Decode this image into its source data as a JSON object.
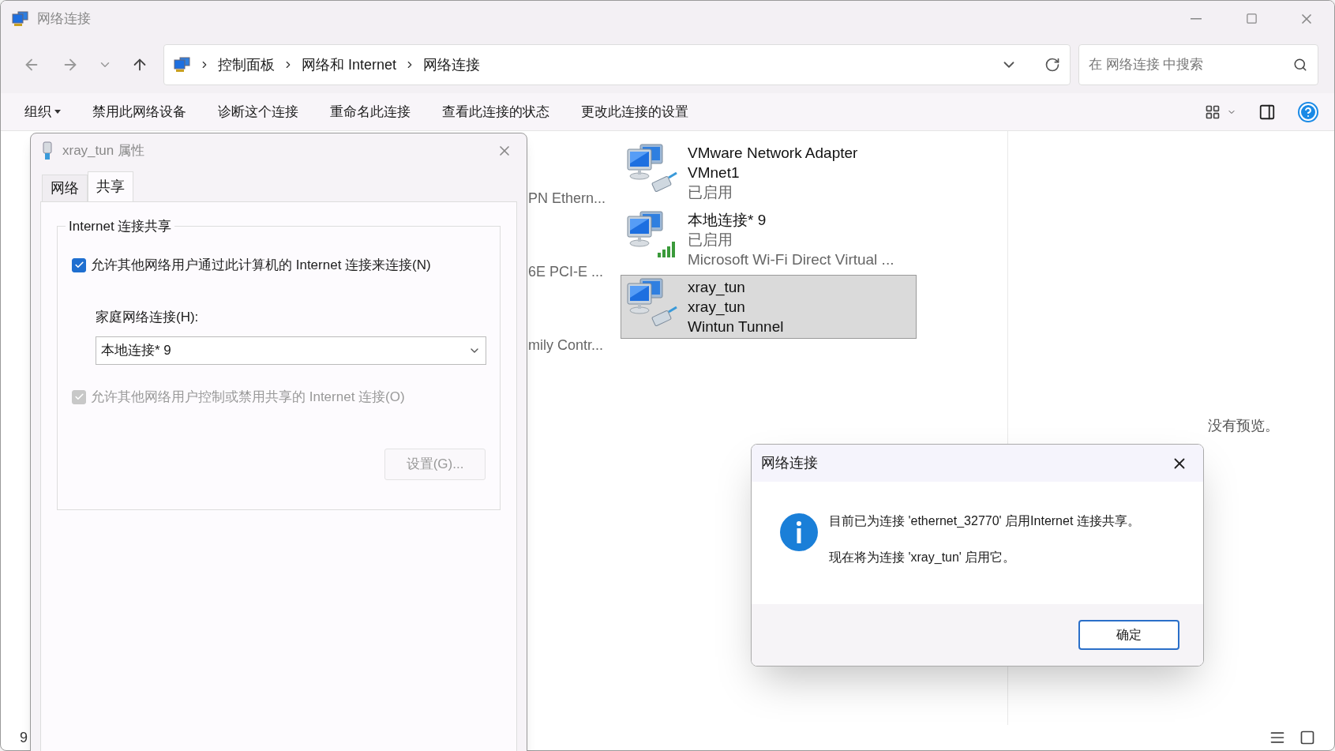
{
  "window": {
    "title": "网络连接"
  },
  "address_bar": {
    "breadcrumbs": [
      "控制面板",
      "网络和 Internet",
      "网络连接"
    ]
  },
  "search": {
    "placeholder": "在 网络连接 中搜索"
  },
  "toolbar": {
    "items": [
      {
        "label": "组织",
        "kind": "menu"
      },
      {
        "label": "禁用此网络设备",
        "kind": "plain"
      },
      {
        "label": "诊断这个连接",
        "kind": "plain"
      },
      {
        "label": "重命名此连接",
        "kind": "plain"
      },
      {
        "label": "查看此连接的状态",
        "kind": "plain"
      },
      {
        "label": "更改此连接的设置",
        "kind": "plain"
      }
    ]
  },
  "left_column_fragments": [
    "PN Ethern...",
    "6E PCI-E ...",
    "mily Contr..."
  ],
  "connections": [
    {
      "lines": [
        "VMware Network Adapter VMnet1",
        "已启用"
      ],
      "kind": "wired",
      "selected": false
    },
    {
      "lines": [
        "本地连接* 9",
        "已启用",
        "Microsoft Wi-Fi Direct Virtual ..."
      ],
      "kind": "wireless",
      "selected": false
    },
    {
      "lines": [
        "xray_tun",
        "xray_tun",
        "Wintun Tunnel"
      ],
      "kind": "wired",
      "selected": true
    }
  ],
  "preview": {
    "text": "没有预览。"
  },
  "status_bar": {
    "count": "9"
  },
  "properties_dialog": {
    "title": "xray_tun 属性",
    "tabs": [
      {
        "label": "网络",
        "selected": false
      },
      {
        "label": "共享",
        "selected": true
      }
    ],
    "group_title": "Internet 连接共享",
    "allow_sharing": {
      "label": "允许其他网络用户通过此计算机的 Internet 连接来连接(N)",
      "checked": true,
      "disabled": false
    },
    "home_network_label": "家庭网络连接(H):",
    "home_network_value": "本地连接* 9",
    "allow_control": {
      "label": "允许其他网络用户控制或禁用共享的 Internet 连接(O)",
      "checked": true,
      "disabled": true
    },
    "settings_button": "设置(G)..."
  },
  "message_dialog": {
    "title": "网络连接",
    "lines": [
      "目前已为连接 'ethernet_32770' 启用Internet 连接共享。",
      "现在将为连接 'xray_tun' 启用它。"
    ],
    "ok_button": "确定"
  }
}
